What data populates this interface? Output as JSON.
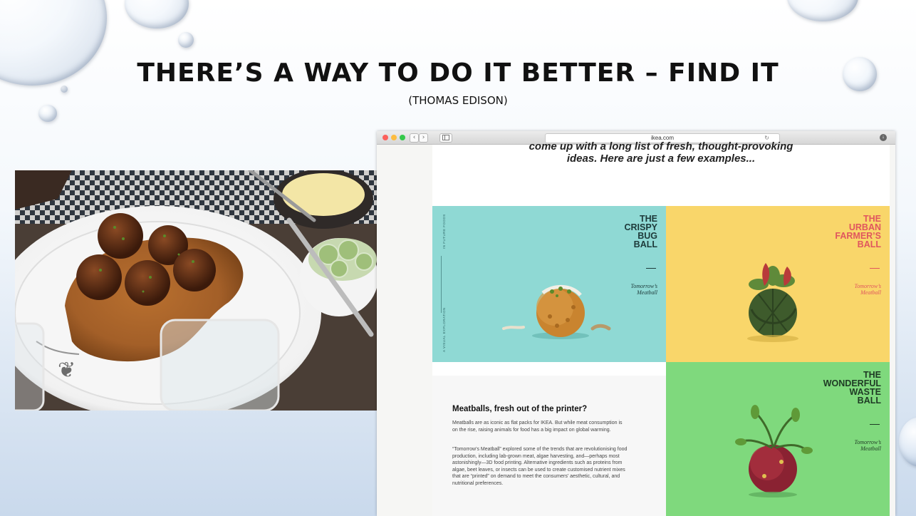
{
  "slide": {
    "title": "THERE’S A WAY TO DO IT BETTER – FIND IT",
    "subtitle": "(THOMAS EDISON)"
  },
  "browser": {
    "url": "ikea.com",
    "back_icon": "chevron-left-icon",
    "forward_icon": "chevron-right-icon",
    "sidebar_icon": "sidebar-icon",
    "reload_icon": "reload-icon",
    "download_icon": "download-icon",
    "traffic_lights": [
      "#fc605b",
      "#fdbc40",
      "#34c84a"
    ]
  },
  "page": {
    "intro_line1": "come up with a long list of fresh, thought-provoking",
    "intro_line2": "ideas. Here are just a few examples...",
    "vertical_top": "IN FUTURE FOODS",
    "vertical_bottom": "A VISUAL EXPLORATION",
    "panels": [
      {
        "title": [
          "THE",
          "CRISPY",
          "BUG",
          "BALL"
        ],
        "script": "Tomorrow’s Meatball",
        "bg": "#8fd9d4",
        "color": "#1d3a3a"
      },
      {
        "title": [
          "THE",
          "URBAN",
          "FARMER’S",
          "BALL"
        ],
        "script": "Tomorrow’s Meatball",
        "bg": "#f9d66a",
        "color": "#e0565e"
      },
      {
        "title": [
          "THE",
          "WONDERFUL",
          "WASTE",
          "BALL"
        ],
        "script": "Tomorrow’s Meatball",
        "bg": "#7fd97d",
        "color": "#1e3a24"
      }
    ],
    "article": {
      "heading": "Meatballs, fresh out of the printer?",
      "para1": "Meatballs are as iconic as flat packs for IKEA. But while meat consumption is on the rise, raising animals for food has a big impact on global warming.",
      "para2": "“Tomorrow’s Meatball” explored some of the trends that are revolutionising food production, including lab-grown meat, algae harvesting, and—perhaps most astonishingly—3D food printing. Alternative ingredients such as proteins from algae, beet leaves, or insects can be used to create customised nutrient mixes that are “printed” on demand to meet the consumers’ aesthetic, cultural, and nutritional preferences."
    }
  }
}
